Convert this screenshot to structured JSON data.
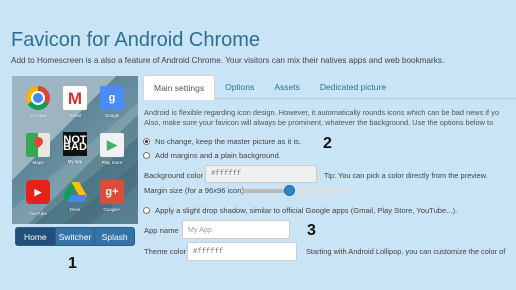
{
  "header": {
    "title": "Favicon for Android Chrome",
    "subtitle": "Add to Homescreen is a also a feature of Android Chrome. Your visitors can mix their natives apps and web bookmarks."
  },
  "preview": {
    "apps": [
      {
        "label": "Chrome",
        "icon": "chrome-icon"
      },
      {
        "label": "Gmail",
        "icon": "gmail-icon",
        "glyph": "M"
      },
      {
        "label": "Google",
        "icon": "google-search-icon",
        "glyph": "g"
      },
      {
        "label": "Maps",
        "icon": "maps-icon"
      },
      {
        "label": "My app",
        "icon": "my-app-icon",
        "glyph_top": "NOT",
        "glyph_bottom": "BAD"
      },
      {
        "label": "Play Store",
        "icon": "play-store-icon",
        "glyph": "▶"
      },
      {
        "label": "YouTube",
        "icon": "youtube-icon",
        "glyph": "▶"
      },
      {
        "label": "Drive",
        "icon": "drive-icon"
      },
      {
        "label": "Google+",
        "icon": "google-plus-icon",
        "glyph": "g+"
      }
    ],
    "switcher": [
      "Home",
      "Switcher",
      "Splash"
    ],
    "switcher_active": "Home"
  },
  "annotations": {
    "one": "1",
    "two": "2",
    "three": "3"
  },
  "tabs": [
    "Main settings",
    "Options",
    "Assets",
    "Dedicated picture"
  ],
  "active_tab": "Main settings",
  "main": {
    "para_line1": "Android is flexible regarding icon design. However, it automatically rounds icons which can be bad news if yo",
    "para_line2": "Also, make sure your favicon will always be prominent, whatever the background. Use the options below to",
    "option_no_change": "No change, keep the master picture as it is.",
    "option_margins": "Add margins and a plain background.",
    "background_color_label": "Background color",
    "background_color_value": "#ffffff",
    "tip": "Tip: You can pick a color directly from the preview.",
    "margin_label": "Margin size (for a 96x96 icon)",
    "margin_slider_fraction": 0.44,
    "option_shadow": "Apply a slight drop shadow, similar to official Google apps (Gmail, Play Store, YouTube...).",
    "app_name_label": "App name",
    "app_name_placeholder": "My App",
    "theme_color_label": "Theme color",
    "theme_color_value": "#ffffff",
    "lollipop_text": "Starting with Android Lollipop, you can customize the color of"
  },
  "colors": {
    "background": "#c9e4f4",
    "title": "#2d6f94",
    "switcher": "#3573a6",
    "slider_thumb": "#2f86c4"
  }
}
